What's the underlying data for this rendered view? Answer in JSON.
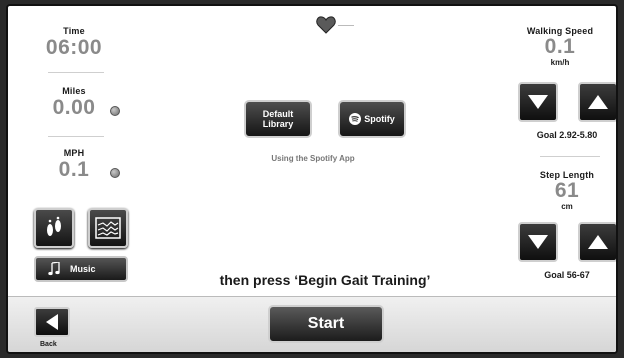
{
  "stats": {
    "time": {
      "label": "Time",
      "value": "06:00"
    },
    "miles": {
      "label": "Miles",
      "value": "0.00"
    },
    "mph": {
      "label": "MPH",
      "value": "0.1"
    }
  },
  "left_buttons": {
    "music_label": "Music"
  },
  "center": {
    "default_library_label": "Default Library",
    "spotify_label": "Spotify",
    "hint": "Using the Spotify App",
    "instruction": "then press ‘Begin Gait Training’"
  },
  "walking_speed": {
    "label": "Walking Speed",
    "value": "0.1",
    "unit": "km/h",
    "goal": "Goal 2.92-5.80"
  },
  "step_length": {
    "label": "Step Length",
    "value": "61",
    "unit": "cm",
    "goal": "Goal 56-67"
  },
  "bottom": {
    "back_label": "Back",
    "start_label": "Start"
  },
  "icons": [
    "heart-icon",
    "footprints-icon",
    "graph-icon",
    "music-note-icon",
    "spotify-logo-icon",
    "arrow-down-icon",
    "arrow-up-icon",
    "arrow-left-icon"
  ]
}
